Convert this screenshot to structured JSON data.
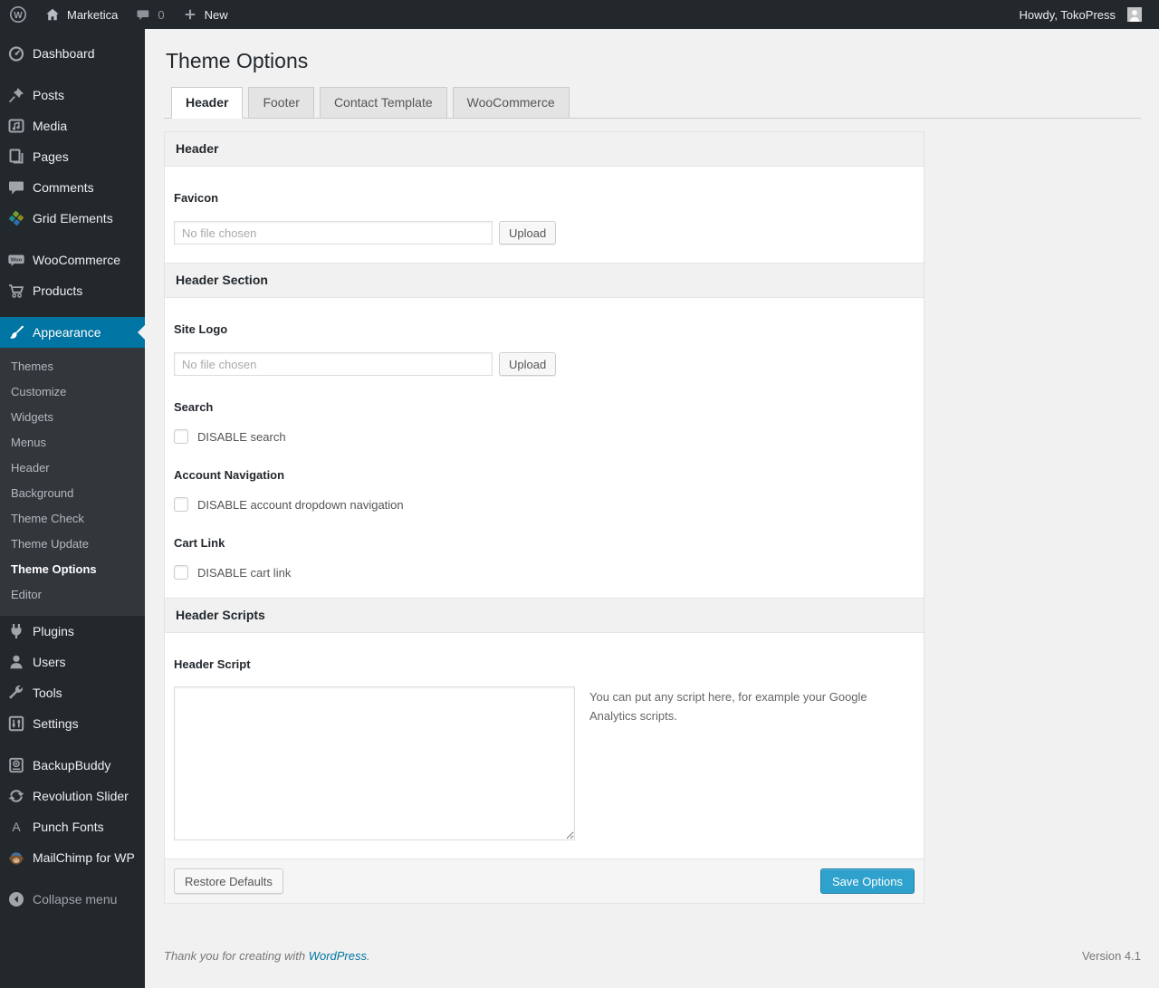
{
  "admin_bar": {
    "site_name": "Marketica",
    "comments_count": "0",
    "new_label": "New",
    "howdy": "Howdy, TokoPress"
  },
  "sidebar": {
    "items": [
      {
        "type": "item",
        "id": "dashboard",
        "label": "Dashboard",
        "icon": "dashboard-icon"
      },
      {
        "type": "separator"
      },
      {
        "type": "item",
        "id": "posts",
        "label": "Posts",
        "icon": "pushpin-icon"
      },
      {
        "type": "item",
        "id": "media",
        "label": "Media",
        "icon": "media-icon"
      },
      {
        "type": "item",
        "id": "pages",
        "label": "Pages",
        "icon": "pages-icon"
      },
      {
        "type": "item",
        "id": "comments",
        "label": "Comments",
        "icon": "comment-icon"
      },
      {
        "type": "item",
        "id": "grid-elements",
        "label": "Grid Elements",
        "icon": "grid-elements-icon"
      },
      {
        "type": "separator"
      },
      {
        "type": "item",
        "id": "woocommerce",
        "label": "WooCommerce",
        "icon": "woocommerce-icon"
      },
      {
        "type": "item",
        "id": "products",
        "label": "Products",
        "icon": "cart-icon"
      },
      {
        "type": "separator"
      },
      {
        "type": "item",
        "id": "appearance",
        "label": "Appearance",
        "icon": "brush-icon",
        "active": true,
        "submenu": [
          {
            "label": "Themes"
          },
          {
            "label": "Customize"
          },
          {
            "label": "Widgets"
          },
          {
            "label": "Menus"
          },
          {
            "label": "Header"
          },
          {
            "label": "Background"
          },
          {
            "label": "Theme Check"
          },
          {
            "label": "Theme Update"
          },
          {
            "label": "Theme Options",
            "current": true
          },
          {
            "label": "Editor"
          }
        ]
      },
      {
        "type": "item",
        "id": "plugins",
        "label": "Plugins",
        "icon": "plugin-icon"
      },
      {
        "type": "item",
        "id": "users",
        "label": "Users",
        "icon": "users-icon"
      },
      {
        "type": "item",
        "id": "tools",
        "label": "Tools",
        "icon": "wrench-icon"
      },
      {
        "type": "item",
        "id": "settings",
        "label": "Settings",
        "icon": "settings-icon"
      },
      {
        "type": "separator"
      },
      {
        "type": "item",
        "id": "backupbuddy",
        "label": "BackupBuddy",
        "icon": "backup-icon"
      },
      {
        "type": "item",
        "id": "revolution-slider",
        "label": "Revolution Slider",
        "icon": "cycle-icon"
      },
      {
        "type": "item",
        "id": "punch-fonts",
        "label": "Punch Fonts",
        "icon": "letter-a-icon"
      },
      {
        "type": "item",
        "id": "mailchimp",
        "label": "MailChimp for WP",
        "icon": "mailchimp-icon"
      },
      {
        "type": "separator"
      },
      {
        "type": "item",
        "id": "collapse-menu",
        "label": "Collapse menu",
        "icon": "collapse-icon",
        "muted": true
      }
    ]
  },
  "main": {
    "title": "Theme Options",
    "tabs": [
      {
        "label": "Header",
        "active": true
      },
      {
        "label": "Footer",
        "active": false
      },
      {
        "label": "Contact Template",
        "active": false
      },
      {
        "label": "WooCommerce",
        "active": false
      }
    ],
    "sections": [
      {
        "type": "section_header",
        "label": "Header"
      },
      {
        "type": "upload_field",
        "name": "favicon",
        "label": "Favicon",
        "value": "",
        "placeholder": "No file chosen",
        "button_label": "Upload"
      },
      {
        "type": "section_header",
        "label": "Header Section"
      },
      {
        "type": "upload_field",
        "name": "site-logo",
        "label": "Site Logo",
        "value": "",
        "placeholder": "No file chosen",
        "button_label": "Upload"
      },
      {
        "type": "checkbox_field",
        "name": "search",
        "label": "Search",
        "checkbox_label": "DISABLE search",
        "checked": false
      },
      {
        "type": "checkbox_field",
        "name": "account-navigation",
        "label": "Account Navigation",
        "checkbox_label": "DISABLE account dropdown navigation",
        "checked": false
      },
      {
        "type": "checkbox_field",
        "name": "cart-link",
        "label": "Cart Link",
        "checkbox_label": "DISABLE cart link",
        "checked": false
      },
      {
        "type": "section_header",
        "label": "Header Scripts"
      },
      {
        "type": "textarea_field",
        "name": "header-script",
        "label": "Header Script",
        "value": "",
        "help": "You can put any script here, for example your Google Analytics scripts."
      }
    ],
    "footer_buttons": {
      "restore_label": "Restore Defaults",
      "save_label": "Save Options"
    }
  },
  "page_footer": {
    "thanks_text": "Thank you for creating with",
    "link_text": "WordPress",
    "period": ".",
    "version": "Version 4.1"
  },
  "colors": {
    "admin_bar_bg": "#23282d",
    "submenu_bg": "#32373c",
    "menu_highlight": "#0074a2",
    "primary_button": "#2ea2cc",
    "page_bg": "#f1f1f1"
  }
}
